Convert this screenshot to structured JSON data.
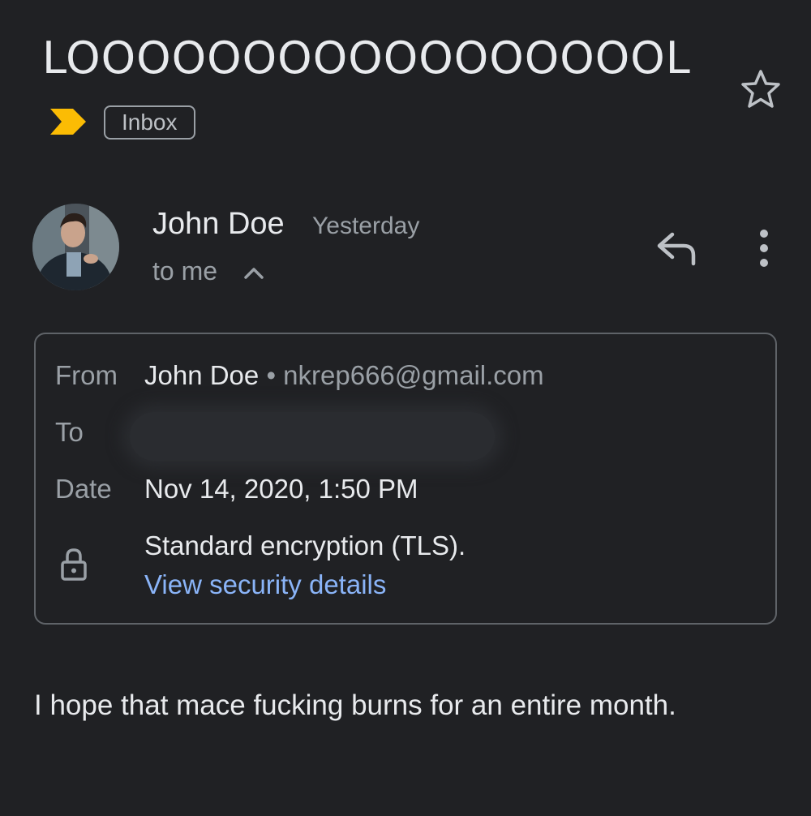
{
  "email": {
    "subject": "LOOOOOOOOOOOOOOOOOL",
    "label": "Inbox",
    "icons": {
      "star": "star-outline-icon",
      "importance": "importance-marker-icon",
      "reply": "reply-icon",
      "more": "more-vert-icon",
      "expand": "chevron-up-icon",
      "lock": "lock-icon"
    },
    "sender": {
      "name": "John Doe",
      "time": "Yesterday",
      "recipient_summary": "to me"
    },
    "details": {
      "from_label": "From",
      "from_name": "John Doe",
      "from_separator": "•",
      "from_email": "nkrep666@gmail.com",
      "to_label": "To",
      "date_label": "Date",
      "date_value": "Nov 14, 2020, 1:50 PM",
      "encryption": "Standard encryption (TLS).",
      "security_link": "View security details"
    },
    "body": "I hope that mace fucking burns for an entire month."
  },
  "colors": {
    "background": "#202124",
    "text_primary": "#e8eaed",
    "text_secondary": "#9aa0a6",
    "link": "#8ab4f8",
    "importance": "#fbbc04"
  }
}
